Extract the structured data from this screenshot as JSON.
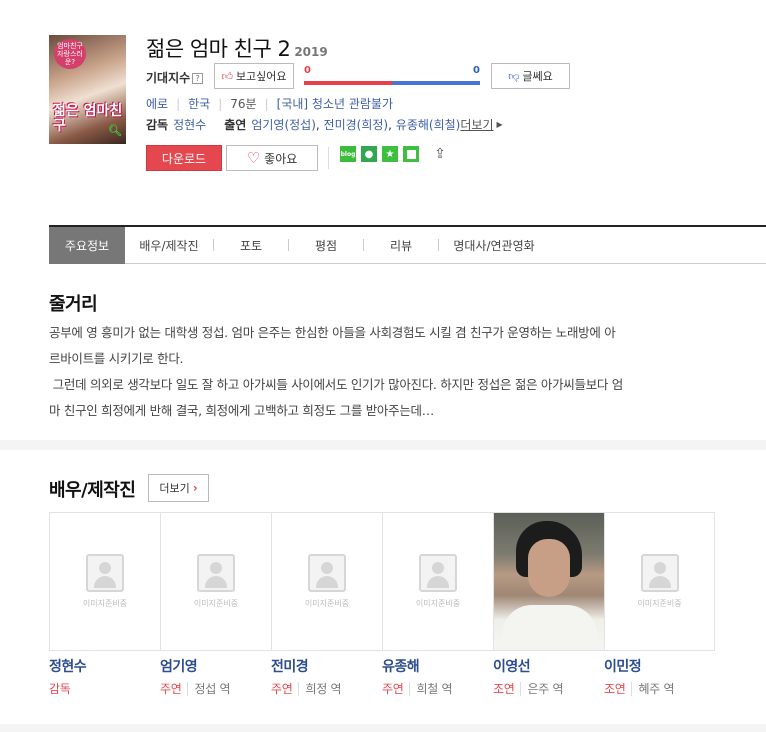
{
  "movie": {
    "poster_tag": "엄마친구 자랑스러운?",
    "poster_title": "젊은 엄마친구",
    "title": "젊은 엄마 친구 2",
    "year": "2019"
  },
  "expectation": {
    "label": "기대지수",
    "help_icon": "?",
    "want_label": "보고싶어요",
    "want_count": "0",
    "meh_count": "0",
    "want_ratio": 0.5,
    "meh_label": "글쎄요"
  },
  "meta": {
    "genre": "에로",
    "country": "한국",
    "runtime": "76분",
    "rating": "[국내] 청소년 관람불가"
  },
  "credits": {
    "director_label": "감독",
    "director": "정현수",
    "cast_label": "출연",
    "cast": [
      {
        "actor": "엄기영",
        "role": "(정섭)",
        "sep": ","
      },
      {
        "actor": "전미경",
        "role": "(희정)",
        "sep": ","
      },
      {
        "actor": "유종해",
        "role": "(희철)",
        "sep": ""
      }
    ],
    "more_label": "더보기"
  },
  "actions": {
    "download_label": "다운로드",
    "like_label": "좋아요",
    "share_icons": [
      "blog",
      "me2day",
      "star",
      "square",
      "share"
    ]
  },
  "tabs": [
    "주요정보",
    "배우/제작진",
    "포토",
    "평점",
    "리뷰",
    "명대사/연관영화"
  ],
  "synopsis": {
    "title": "줄거리",
    "line1": "공부에 영 흥미가 없는 대학생 정섭. 엄마 은주는 한심한 아들을 사회경험도 시킬 겸 친구가 운영하는 노래방에 아",
    "line2": "르바이트를 시키기로 한다.",
    "line3": " 그런데 의외로 생각보다 일도 잘 하고 아가씨들 사이에서도 인기가 많아진다. 하지만 정섭은 젊은 아가씨들보다 엄",
    "line4": "마 친구인 희정에게 반해 결국, 희정에게 고백하고 희정도 그를 받아주는데…"
  },
  "cast_section": {
    "title": "배우/제작진",
    "more_label": "더보기",
    "placeholder_text": "이미지준비중",
    "members": [
      {
        "name": "정현수",
        "kind": "감독",
        "character": ""
      },
      {
        "name": "엄기영",
        "kind": "주연",
        "character": "정섭 역"
      },
      {
        "name": "전미경",
        "kind": "주연",
        "character": "희정 역"
      },
      {
        "name": "유종해",
        "kind": "주연",
        "character": "희철 역"
      },
      {
        "name": "이영선",
        "kind": "조연",
        "character": "은주 역"
      },
      {
        "name": "이민정",
        "kind": "조연",
        "character": "혜주 역"
      }
    ]
  },
  "colors": {
    "accent_red": "#e5474f",
    "link_blue": "#3d5fa5",
    "name_blue": "#2d4d8f",
    "green_share": "#3fbf3f"
  }
}
